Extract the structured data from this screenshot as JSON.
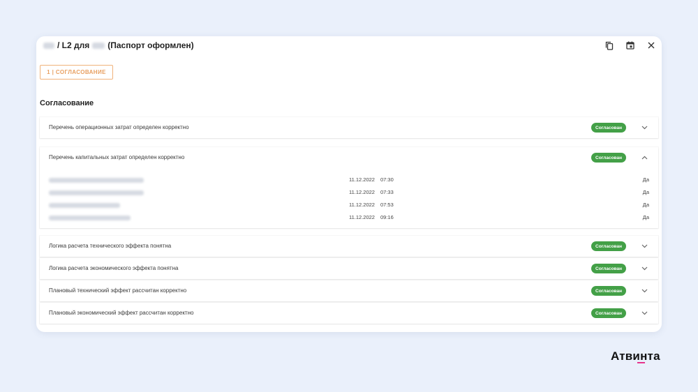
{
  "header": {
    "title_part1": "/ L2 для",
    "title_part2": "(Паспорт оформлен)"
  },
  "stage_tab": {
    "label": "1 | СОГЛАСОВАНИЕ"
  },
  "section": {
    "title": "Согласование"
  },
  "rows": [
    {
      "label": "Перечень операционных затрат определен корректно",
      "status": "Согласован",
      "expanded": false
    },
    {
      "label": "Перечень капитальных затрат определен корректно",
      "status": "Согласован",
      "expanded": true
    },
    {
      "label": "Логика расчета технического эффекта понятна",
      "status": "Согласован",
      "expanded": false
    },
    {
      "label": "Логика расчета экономического эффекта понятна",
      "status": "Согласован",
      "expanded": false
    },
    {
      "label": "Плановый технический эффект рассчитан корректно",
      "status": "Согласован",
      "expanded": false
    },
    {
      "label": "Плановый экономический эффект рассчитан корректно",
      "status": "Согласован",
      "expanded": false
    }
  ],
  "approvals": [
    {
      "date": "11.12.2022",
      "time": "07:30",
      "answer": "Да"
    },
    {
      "date": "11.12.2022",
      "time": "07:33",
      "answer": "Да"
    },
    {
      "date": "11.12.2022",
      "time": "07:53",
      "answer": "Да"
    },
    {
      "date": "11.12.2022",
      "time": "09:16",
      "answer": "Да"
    }
  ],
  "brand": {
    "name": "Атвинта"
  },
  "colors": {
    "background": "#eaf0fb",
    "accent_orange": "#e8a062",
    "status_green": "#43a047",
    "brand_pink": "#e6348c"
  },
  "icons": [
    "copy-icon",
    "calendar-icon",
    "close-icon",
    "chevron-down-icon",
    "chevron-up-icon"
  ]
}
